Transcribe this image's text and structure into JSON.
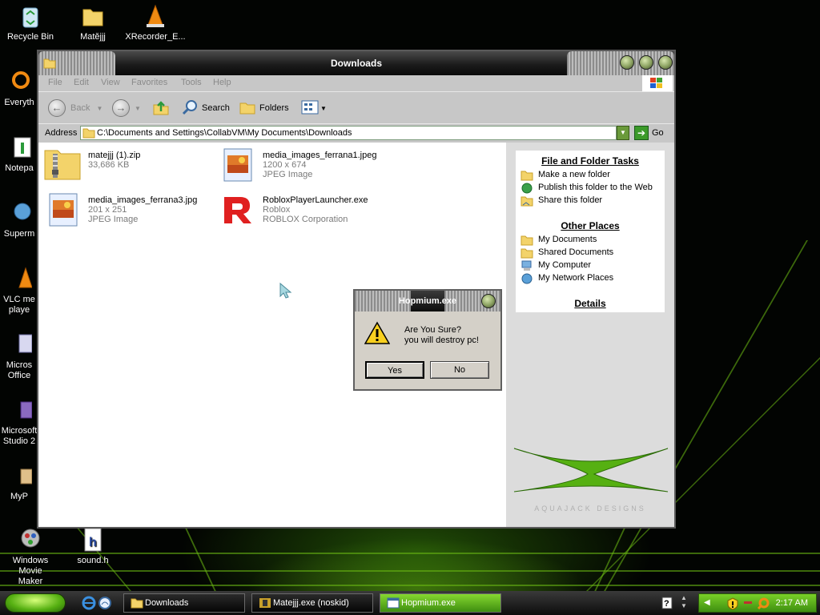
{
  "desktop": {
    "icons": [
      {
        "label": "Recycle Bin"
      },
      {
        "label": "Matějjj"
      },
      {
        "label": "XRecorder_E..."
      },
      {
        "label": "Everyth"
      },
      {
        "label": "Notepa"
      },
      {
        "label": "Superm"
      },
      {
        "label": "VLC me"
      },
      {
        "label": "playe"
      },
      {
        "label": "Micros"
      },
      {
        "label": "Office"
      },
      {
        "label": "Microsoft"
      },
      {
        "label": "Studio 2"
      },
      {
        "label": "MyP"
      },
      {
        "label": "Windows Movie"
      },
      {
        "label": "Maker"
      },
      {
        "label": "sound.h"
      }
    ]
  },
  "window": {
    "title": "Downloads",
    "menu": [
      "File",
      "Edit",
      "View",
      "Favorites",
      "Tools",
      "Help"
    ],
    "toolbar": {
      "back": "Back",
      "search": "Search",
      "folders": "Folders"
    },
    "address": {
      "label": "Address",
      "value": "C:\\Documents and Settings\\CollabVM\\My Documents\\Downloads",
      "go": "Go"
    },
    "files": [
      {
        "name": "matejjj (1).zip",
        "line1": "33,686 KB",
        "line2": ""
      },
      {
        "name": "media_images_ferrana1.jpeg",
        "line1": "1200 x 674",
        "line2": "JPEG Image"
      },
      {
        "name": "media_images_ferrana3.jpg",
        "line1": "201 x 251",
        "line2": "JPEG Image"
      },
      {
        "name": "RobloxPlayerLauncher.exe",
        "line1": "Roblox",
        "line2": "ROBLOX Corporation"
      }
    ],
    "task_pane": {
      "file_tasks": {
        "heading": "File and Folder Tasks",
        "items": [
          "Make a new folder",
          "Publish this folder to the Web",
          "Share this folder"
        ]
      },
      "other_places": {
        "heading": "Other Places",
        "items": [
          "My Documents",
          "Shared Documents",
          "My Computer",
          "My Network Places"
        ]
      },
      "details": {
        "heading": "Details"
      },
      "watermark": "AQUAJACK DESIGNS"
    }
  },
  "dialog": {
    "title": "Hopmium.exe",
    "message_line1": "Are You Sure?",
    "message_line2": "you will destroy pc!",
    "yes": "Yes",
    "no": "No"
  },
  "taskbar": {
    "tasks": [
      {
        "label": "Downloads"
      },
      {
        "label": "Matejjj.exe (noskid)"
      },
      {
        "label": "Hopmium.exe"
      }
    ],
    "clock": "2:17 AM"
  },
  "colors": {
    "accent_green": "#56b012",
    "title_dark": "#1c1c1c",
    "task_pane_bg": "#dcdcdc"
  }
}
